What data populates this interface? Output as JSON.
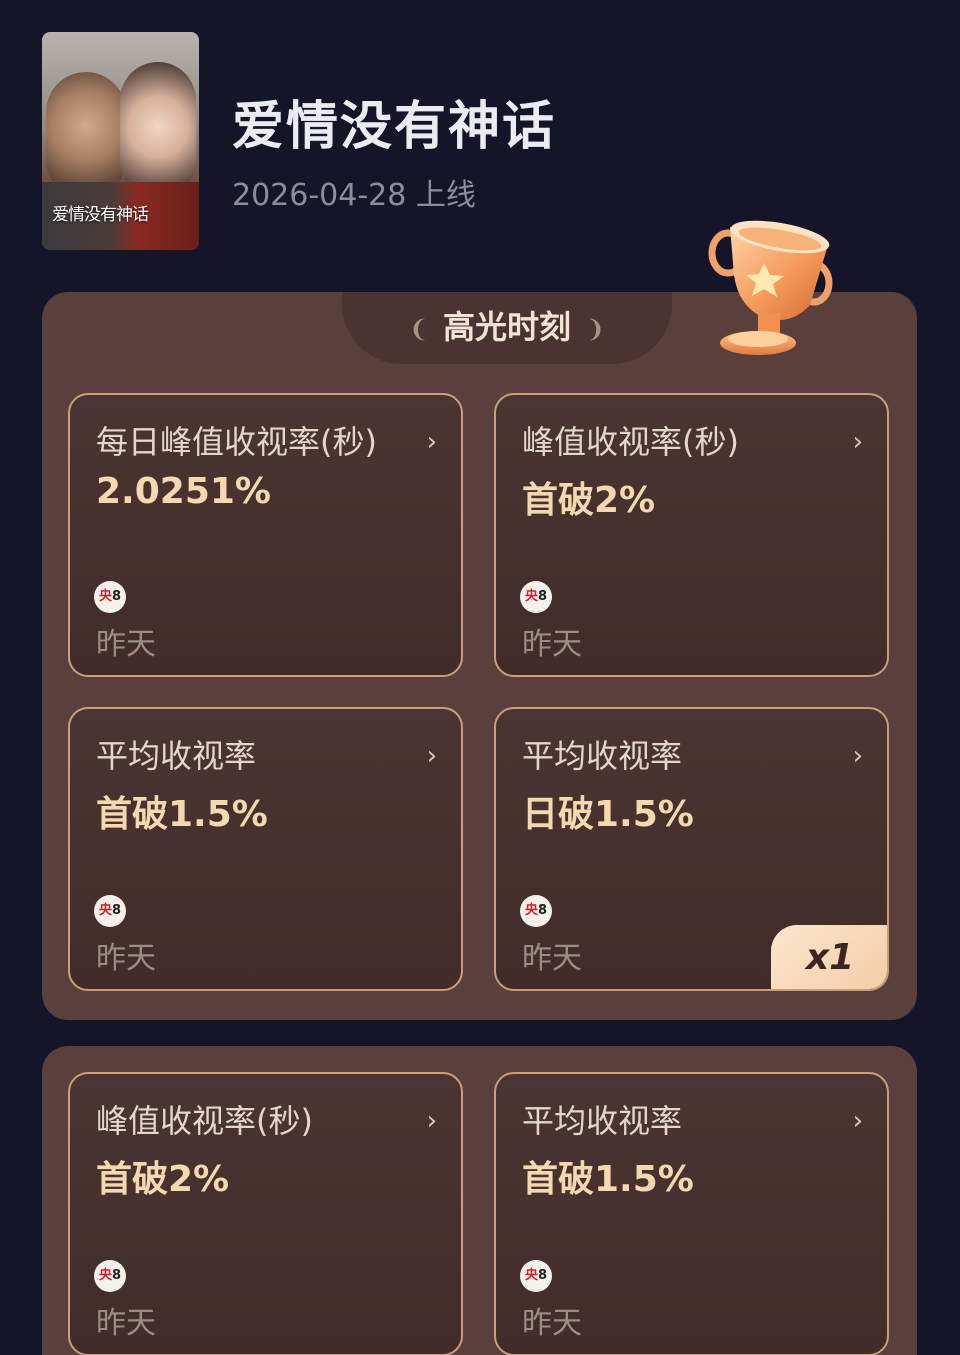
{
  "show": {
    "title": "爱情没有神话",
    "release": "2026-04-28 上线",
    "poster_title": "爱情没有神话"
  },
  "highlights": {
    "heading": "高光时刻",
    "cards": [
      {
        "title": "每日峰值收视率(秒)",
        "value": "2.0251%",
        "channel": "央8",
        "time": "昨天"
      },
      {
        "title": "峰值收视率(秒)",
        "value": "首破2%",
        "channel": "央8",
        "time": "昨天"
      },
      {
        "title": "平均收视率",
        "value": "首破1.5%",
        "channel": "央8",
        "time": "昨天"
      },
      {
        "title": "平均收视率",
        "value": "日破1.5%",
        "channel": "央8",
        "time": "昨天",
        "badge": "x1"
      }
    ]
  },
  "highlights2": {
    "cards": [
      {
        "title": "峰值收视率(秒)",
        "value": "首破2%",
        "channel": "央8",
        "time": "昨天"
      },
      {
        "title": "平均收视率",
        "value": "首破1.5%",
        "channel": "央8",
        "time": "昨天"
      }
    ]
  },
  "icons": {
    "arrow": "chevron-right-icon",
    "trophy": "trophy-icon",
    "channel": "cctv8-logo-icon"
  },
  "colors": {
    "background": "#15152a",
    "panel": "#59403c",
    "card_border": "#c99f78",
    "value_text": "#f4d9b0"
  }
}
